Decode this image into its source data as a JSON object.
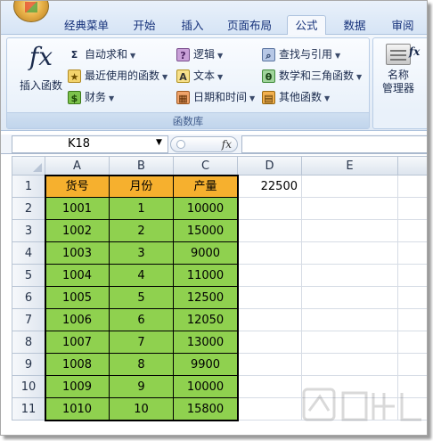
{
  "ribbon": {
    "tabs": [
      "经典菜单",
      "开始",
      "插入",
      "页面布局",
      "公式",
      "数据",
      "审阅"
    ],
    "active_tab": "公式",
    "insert_function_label": "插入函数",
    "commands": {
      "autosum": "自动求和",
      "recent": "最近使用的函数",
      "finance": "财务",
      "logic": "逻辑",
      "text": "文本",
      "datetime": "日期和时间",
      "lookup": "查找与引用",
      "math": "数学和三角函数",
      "other": "其他函数"
    },
    "group_label": "函数库",
    "name_manager_label_1": "名称",
    "name_manager_label_2": "管理器",
    "fx_side": "fx"
  },
  "formula_bar": {
    "name_box": "K18",
    "fx_label": "fx",
    "formula": ""
  },
  "sheet": {
    "columns": [
      "A",
      "B",
      "C",
      "D",
      "E"
    ],
    "rows": [
      "1",
      "2",
      "3",
      "4",
      "5",
      "6",
      "7",
      "8",
      "9",
      "10",
      "11"
    ],
    "headers": [
      "货号",
      "月份",
      "产量"
    ],
    "d1_value": "22500",
    "data": [
      [
        "1001",
        "1",
        "10000"
      ],
      [
        "1002",
        "2",
        "15000"
      ],
      [
        "1003",
        "3",
        "9000"
      ],
      [
        "1004",
        "4",
        "11000"
      ],
      [
        "1005",
        "5",
        "12500"
      ],
      [
        "1006",
        "6",
        "12050"
      ],
      [
        "1007",
        "7",
        "13000"
      ],
      [
        "1008",
        "8",
        "9900"
      ],
      [
        "1009",
        "9",
        "10000"
      ],
      [
        "1010",
        "10",
        "15800"
      ]
    ]
  },
  "colors": {
    "header_fill": "#f6b02e",
    "data_fill": "#8fd14f"
  }
}
